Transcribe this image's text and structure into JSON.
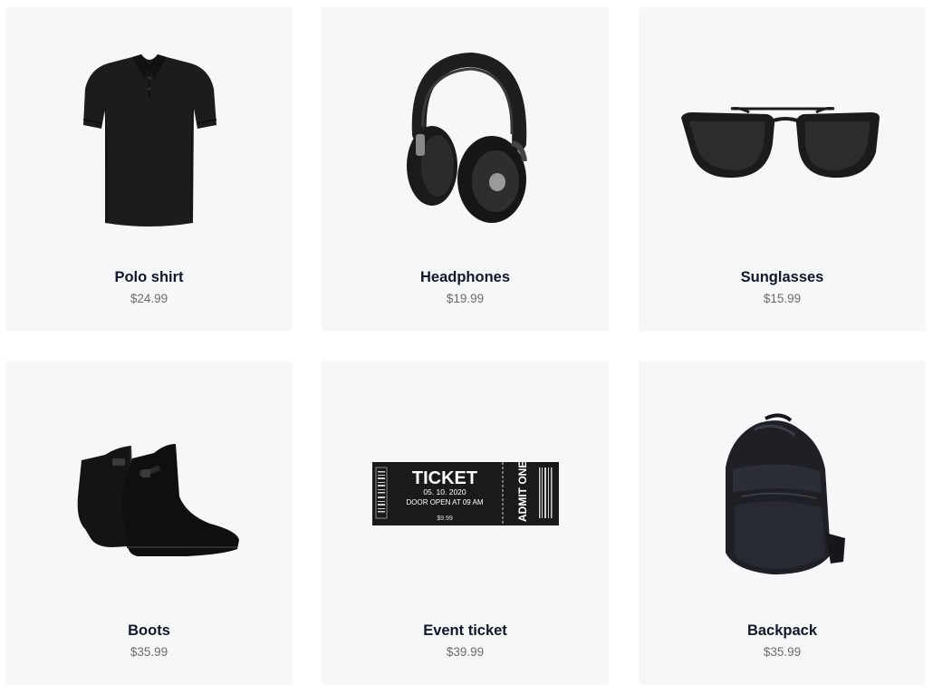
{
  "products": [
    {
      "name": "Polo shirt",
      "price": "$24.99",
      "image_icon": "polo-shirt-icon"
    },
    {
      "name": "Headphones",
      "price": "$19.99",
      "image_icon": "headphones-icon"
    },
    {
      "name": "Sunglasses",
      "price": "$15.99",
      "image_icon": "sunglasses-icon"
    },
    {
      "name": "Boots",
      "price": "$35.99",
      "image_icon": "boots-icon"
    },
    {
      "name": "Event ticket",
      "price": "$39.99",
      "image_icon": "event-ticket-icon",
      "ticket_text": {
        "title": "TICKET",
        "date": "05. 10. 2020",
        "door": "DOOR OPEN AT 09 AM",
        "small": "$9.99",
        "stub": "ADMIT ONE"
      }
    },
    {
      "name": "Backpack",
      "price": "$35.99",
      "image_icon": "backpack-icon"
    }
  ],
  "colors": {
    "card_bg": "#f6f7f9",
    "name": "#111827",
    "price": "#6b6b6b",
    "product": "#1a1a1a"
  }
}
